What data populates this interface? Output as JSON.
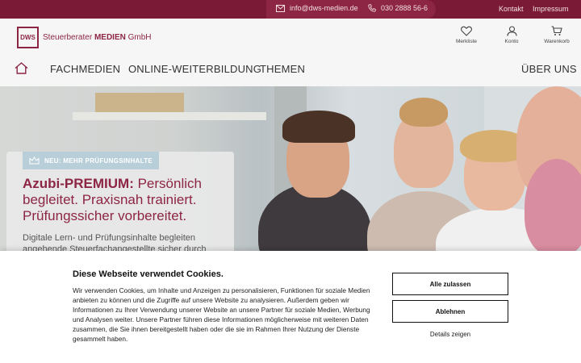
{
  "topbar": {
    "email": "info@dws-medien.de",
    "phone": "030 2888 56-6",
    "links": [
      "Kontakt",
      "Impressum"
    ],
    "icons": [
      "mail-icon",
      "phone-icon"
    ]
  },
  "header": {
    "logo": {
      "mark": "DWS",
      "text_prefix": "Steuerberater",
      "text_bold": "MEDIEN",
      "text_suffix": "GmbH"
    },
    "actions": [
      {
        "label": "Merkliste",
        "icon": "heart-icon"
      },
      {
        "label": "Konto",
        "icon": "user-icon"
      },
      {
        "label": "Warenkorb",
        "icon": "cart-icon"
      }
    ],
    "nav": [
      "FACHMEDIEN",
      "ONLINE-WEITERBILDUNG",
      "THEMEN",
      "ÜBER UNS"
    ],
    "home_icon": "home-icon"
  },
  "hero": {
    "badge": "NEU: MEHR PRÜFUNGSINHALTE",
    "badge_icon": "crown-icon",
    "title_bold": "Azubi-PREMIUM:",
    "title_rest": " Persönlich begleitet. Praxisnah trainiert. Prüfungssicher vorbereitet.",
    "description": "Digitale Lern- und Prüfungsinhalte begleiten angehende Steuerfachangestellte sicher durch"
  },
  "cookie": {
    "title": "Diese Webseite verwendet Cookies.",
    "text": "Wir verwenden Cookies, um Inhalte und Anzeigen zu personalisieren, Funktionen für soziale Medien anbieten zu können und die Zugriffe auf unsere Website zu analysieren. Außerdem geben wir Informationen zu Ihrer Verwendung unserer Website an unsere Partner für soziale Medien, Werbung und Analysen weiter. Unsere Partner führen diese Informationen möglicherweise mit weiteren Daten zusammen, die Sie ihnen bereitgestellt haben oder die sie im Rahmen Ihrer Nutzung der Dienste gesammelt haben.",
    "allow_all": "Alle zulassen",
    "deny": "Ablehnen",
    "details": "Details zeigen"
  },
  "colors": {
    "brand": "#8d2544",
    "topbar": "#7a1a36",
    "badge": "#b8cfda"
  }
}
